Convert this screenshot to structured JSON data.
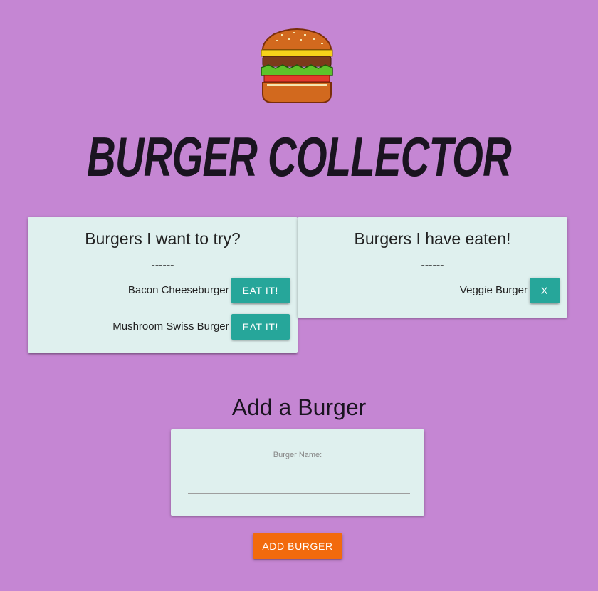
{
  "header": {
    "logo_icon": "pixel-burger-icon",
    "title": "BURGER COLLECTOR"
  },
  "want_list": {
    "heading": "Burgers I want to try?",
    "separator": "------",
    "items": [
      {
        "name": "Bacon Cheeseburger",
        "button": "EAT IT!"
      },
      {
        "name": "Mushroom Swiss Burger",
        "button": "EAT IT!"
      }
    ]
  },
  "eaten_list": {
    "heading": "Burgers I have eaten!",
    "separator": "------",
    "items": [
      {
        "name": "Veggie Burger",
        "button": "X"
      }
    ]
  },
  "add_form": {
    "heading": "Add a Burger",
    "label": "Burger Name:",
    "input_value": "",
    "submit": "ADD BURGER"
  },
  "colors": {
    "background": "#c586d3",
    "card": "#dff0ee",
    "button_teal": "#26a69a",
    "button_orange": "#f26a0d"
  }
}
